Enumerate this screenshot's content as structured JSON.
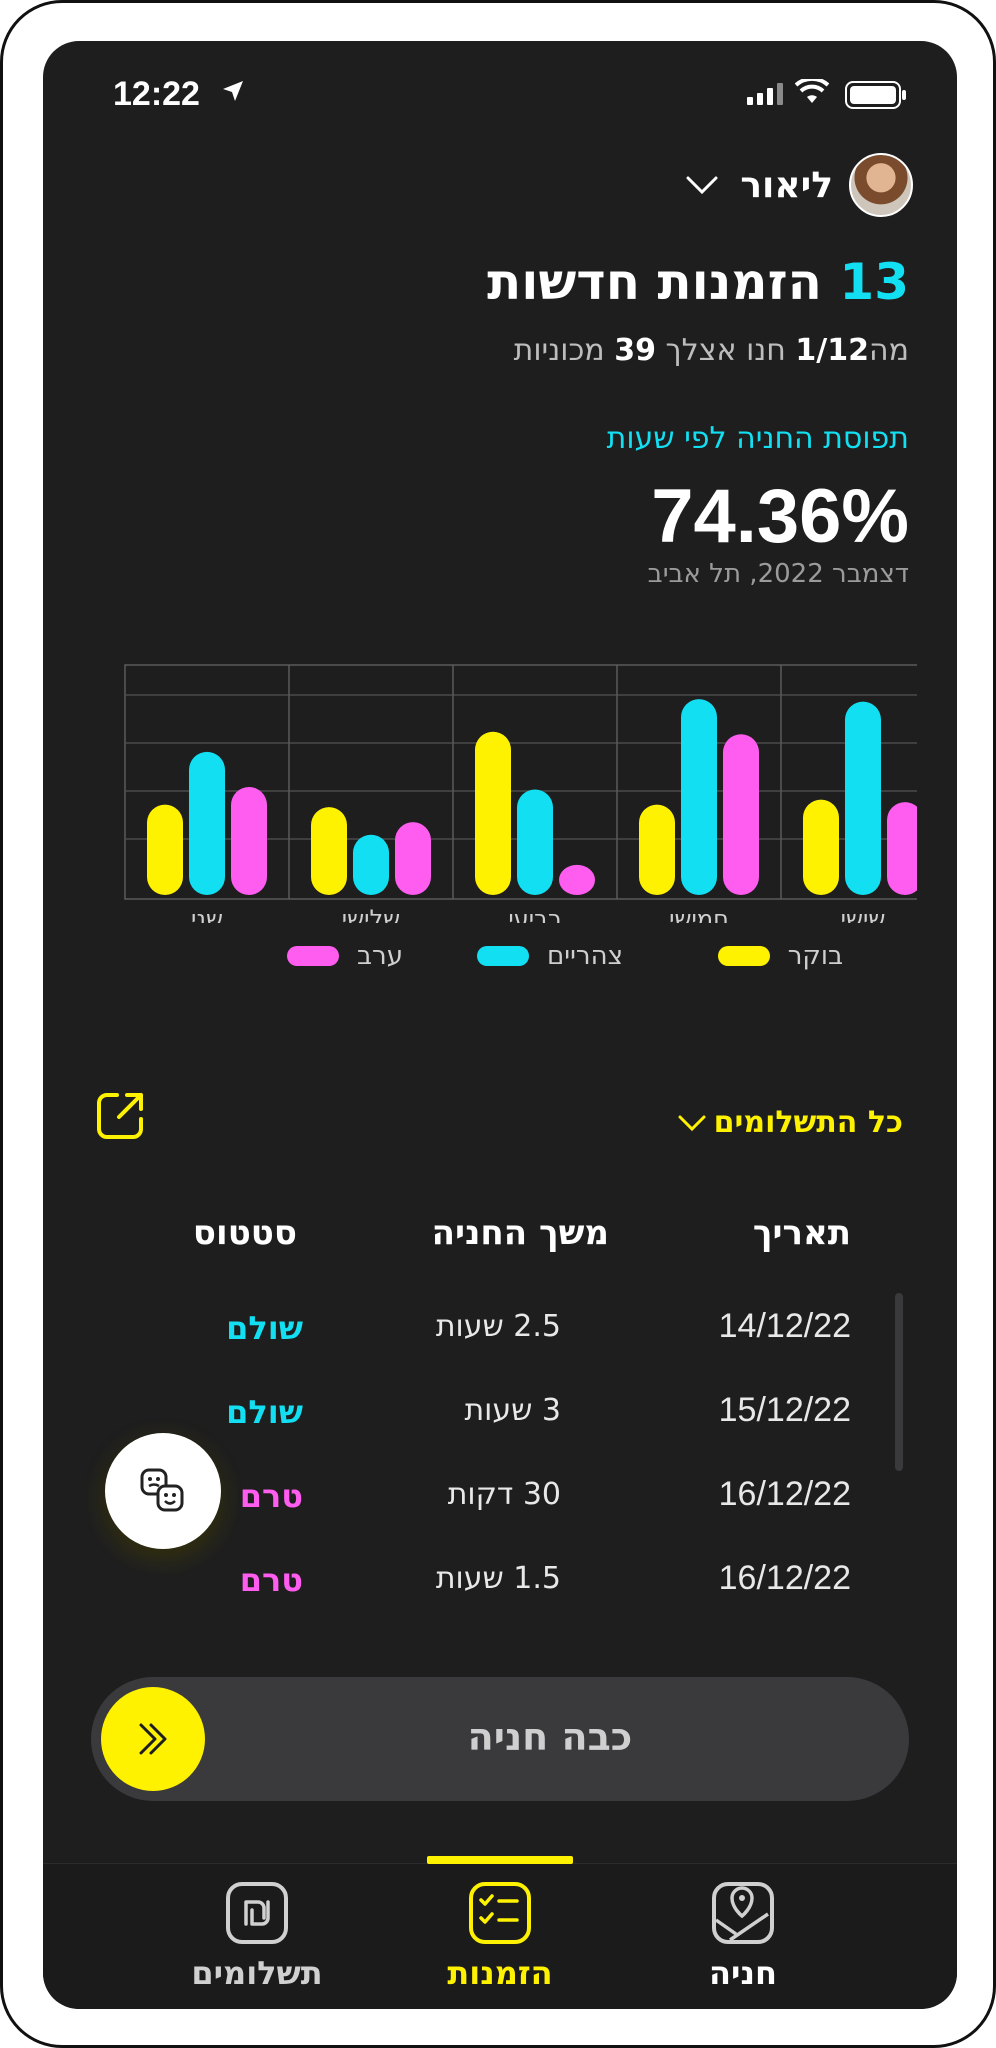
{
  "status_bar": {
    "time": "12:22"
  },
  "user": {
    "name": "ליאור"
  },
  "summary": {
    "count": "13",
    "title": "הזמנות חדשות",
    "sub_prefix": "מה",
    "sub_date": "1/12",
    "sub_mid": "חנו אצלך",
    "sub_cars": "39",
    "sub_suffix": "מכוניות"
  },
  "occupancy": {
    "label": "תפוסת החניה לפי שעות",
    "value": "74.36%",
    "period": "דצמבר 2022, תל אביב"
  },
  "chart_data": {
    "type": "bar",
    "categories": [
      "שני",
      "שלישי",
      "רביעי",
      "חמישי",
      "שישי"
    ],
    "series": [
      {
        "name": "בוקר",
        "color": "#fff200",
        "values": [
          36,
          35,
          65,
          36,
          38
        ]
      },
      {
        "name": "צהריים",
        "color": "#12dff2",
        "values": [
          57,
          24,
          42,
          78,
          77
        ]
      },
      {
        "name": "ערב",
        "color": "#ff5cf0",
        "values": [
          43,
          29,
          12,
          64,
          37
        ]
      }
    ],
    "ylim": [
      0,
      90
    ],
    "grid": true,
    "legend_position": "bottom"
  },
  "filter": {
    "label": "כל התשלומים"
  },
  "table": {
    "headers": {
      "date": "תאריך",
      "duration": "משך החניה",
      "status": "סטטוס"
    },
    "rows": [
      {
        "date": "14/12/22",
        "duration": "2.5 שעות",
        "status": "שולם",
        "status_color": "#12dff2"
      },
      {
        "date": "15/12/22",
        "duration": "3 שעות",
        "status": "שולם",
        "status_color": "#12dff2"
      },
      {
        "date": "16/12/22",
        "duration": "30 דקות",
        "status": "טרם",
        "status_color": "#ff5cf0"
      },
      {
        "date": "16/12/22",
        "duration": "1.5 שעות",
        "status": "טרם",
        "status_color": "#ff5cf0"
      }
    ]
  },
  "slider": {
    "label": "כבה חניה"
  },
  "tabs": [
    {
      "label": "חניה",
      "icon": "map-pin-icon",
      "active": false
    },
    {
      "label": "הזמנות",
      "icon": "checklist-icon",
      "active": true
    },
    {
      "label": "תשלומים",
      "icon": "shekel-icon",
      "active": false
    }
  ],
  "colors": {
    "accent_yellow": "#fff200",
    "accent_cyan": "#12dff2",
    "accent_pink": "#ff5cf0",
    "background": "#1e1e1f"
  }
}
